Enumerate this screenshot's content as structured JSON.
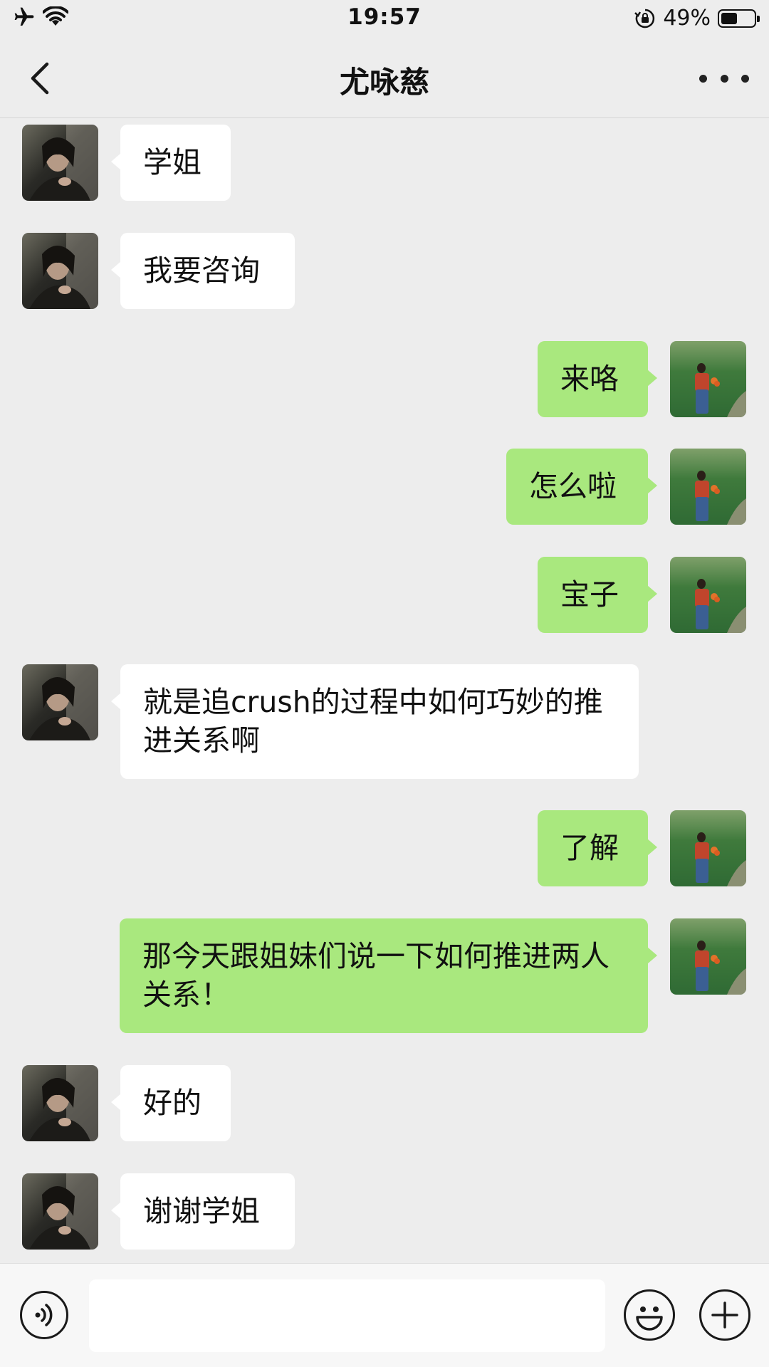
{
  "status_bar": {
    "time": "19:57",
    "battery_percent_text": "49%",
    "battery_level": 0.49,
    "icons": [
      "airplane-icon",
      "wifi-icon",
      "orientation-lock-icon",
      "battery-icon"
    ]
  },
  "nav": {
    "title": "尤咏慈",
    "back_icon": "chevron-left-icon",
    "more_icon": "more-dots-icon"
  },
  "messages": [
    {
      "side": "left",
      "text": "学姐"
    },
    {
      "side": "left",
      "text": "我要咨询"
    },
    {
      "side": "right",
      "text": "来咯"
    },
    {
      "side": "right",
      "text": "怎么啦"
    },
    {
      "side": "right",
      "text": "宝子"
    },
    {
      "side": "left",
      "text": "就是追crush的过程中如何巧妙的推进关系啊"
    },
    {
      "side": "right",
      "text": "了解"
    },
    {
      "side": "right",
      "text": "那今天跟姐妹们说一下如何推进两人关系！"
    },
    {
      "side": "left",
      "text": "好的"
    },
    {
      "side": "left",
      "text": "谢谢学姐"
    }
  ],
  "input_bar": {
    "value": "",
    "icons": [
      "voice-icon",
      "emoji-icon",
      "plus-icon"
    ]
  },
  "colors": {
    "background": "#EDEDED",
    "sent_bubble": "#A9E87E",
    "received_bubble": "#FFFFFF"
  }
}
